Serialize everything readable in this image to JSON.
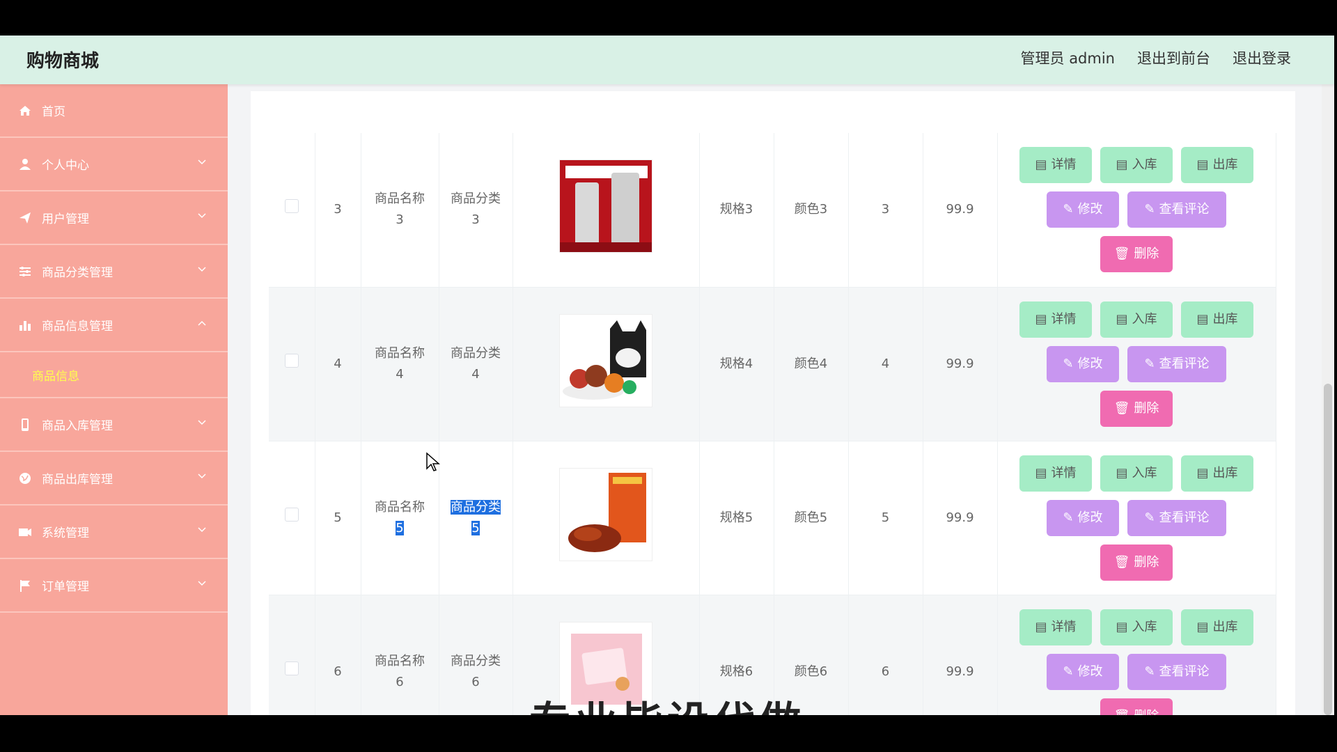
{
  "app": {
    "brand": "购物商城"
  },
  "header": {
    "admin_label": "管理员 admin",
    "front_label": "退出到前台",
    "logout_label": "退出登录"
  },
  "sidebar": {
    "items": [
      {
        "label": "首页",
        "icon": "home-icon"
      },
      {
        "label": "个人中心",
        "icon": "user-icon"
      },
      {
        "label": "用户管理",
        "icon": "send-icon"
      },
      {
        "label": "商品分类管理",
        "icon": "sliders-icon"
      },
      {
        "label": "商品信息管理",
        "icon": "bar-chart-icon"
      },
      {
        "label": "商品入库管理",
        "icon": "phone-icon"
      },
      {
        "label": "商品出库管理",
        "icon": "globe-icon"
      },
      {
        "label": "系统管理",
        "icon": "camera-icon"
      },
      {
        "label": "订单管理",
        "icon": "flag-icon"
      }
    ],
    "active_sub": "商品信息"
  },
  "rows": [
    {
      "id": "3",
      "name": "商品名称3",
      "name_line1": "商品名称",
      "name_line2": "3",
      "category_line1": "商品分类",
      "category_line2": "3",
      "spec": "规格3",
      "color": "颜色3",
      "qty": "3",
      "price": "99.9"
    },
    {
      "id": "4",
      "name": "商品名称4",
      "name_line1": "商品名称",
      "name_line2": "4",
      "category_line1": "商品分类",
      "category_line2": "4",
      "spec": "规格4",
      "color": "颜色4",
      "qty": "4",
      "price": "99.9"
    },
    {
      "id": "5",
      "name": "商品名称5",
      "name_line1": "商品名称",
      "name_line2": "5",
      "category_line1": "商品分类",
      "category_line2": "5",
      "spec": "规格5",
      "color": "颜色5",
      "qty": "5",
      "price": "99.9"
    },
    {
      "id": "6",
      "name": "商品名称6",
      "name_line1": "商品名称",
      "name_line2": "6",
      "category_line1": "商品分类",
      "category_line2": "6",
      "spec": "规格6",
      "color": "颜色6",
      "qty": "6",
      "price": "99.9"
    }
  ],
  "buttons": {
    "detail": "详情",
    "instock": "入库",
    "outstock": "出库",
    "edit": "修改",
    "comments": "查看评论",
    "delete": "删除"
  },
  "colors": {
    "header_bg": "#d9f1e6",
    "sidebar_bg": "#f8a69b",
    "green_btn": "#a5ecc6",
    "purple_btn": "#c896f0",
    "pink_btn": "#f06bb1",
    "highlight": "#1e6fe0"
  },
  "watermark": "专业毕设代做"
}
